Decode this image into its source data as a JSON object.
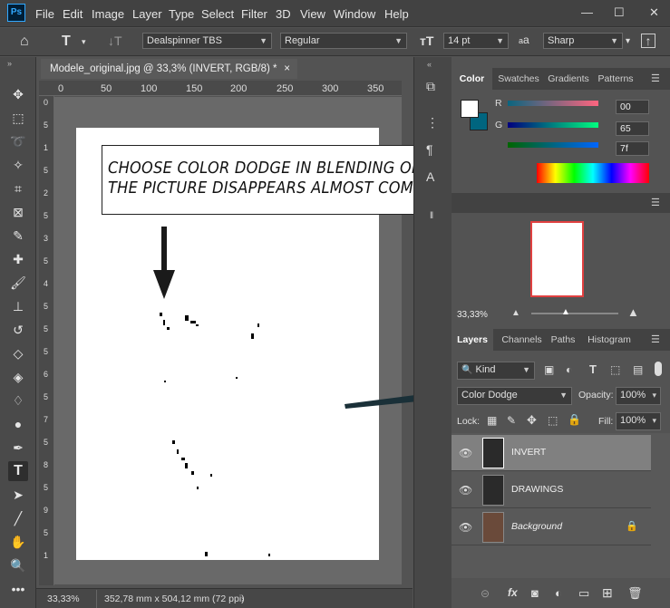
{
  "app": {
    "logo": "Ps"
  },
  "menu": [
    "File",
    "Edit",
    "Image",
    "Layer",
    "Type",
    "Select",
    "Filter",
    "3D",
    "View",
    "Window",
    "Help"
  ],
  "window_controls": [
    "—",
    "☐",
    "✕"
  ],
  "options_bar": {
    "font_family": "Dealspinner TBS",
    "font_style": "Regular",
    "font_size": "14 pt",
    "aa_label": "a",
    "anti_alias": "Sharp"
  },
  "document": {
    "tab_title": "Modele_original.jpg @ 33,3% (INVERT, RGB/8) *",
    "close_glyph": "×",
    "ruler_ticks": [
      "0",
      "50",
      "100",
      "150",
      "200",
      "250",
      "300",
      "350"
    ],
    "ruler_v_ticks": [
      "0",
      "5",
      "1",
      "5",
      "2",
      "5",
      "3",
      "5",
      "4",
      "5",
      "5",
      "5",
      "6",
      "5",
      "7",
      "5",
      "8",
      "5",
      "9",
      "5",
      "1"
    ]
  },
  "annotation": {
    "line1": "CHOOSE COLOR DODGE IN BLENDING OPTIONS",
    "line2": "THE PICTURE DISAPPEARS ALMOST COMPLETELY"
  },
  "status": {
    "zoom": "33,33%",
    "dimensions": "352,78 mm x 504,12 mm (72 ppi)",
    "arrow": "›"
  },
  "color_panel": {
    "tabs": [
      "Color",
      "Swatches",
      "Gradients",
      "Patterns"
    ],
    "r_label": "R",
    "r_value": "00",
    "g_label": "G",
    "g_value": "65",
    "b_value": "7f",
    "foreground": "#ffffff",
    "background": "#00657f"
  },
  "navigator": {
    "zoom": "33,33%"
  },
  "layers_panel": {
    "tabs": [
      "Layers",
      "Channels",
      "Paths",
      "Histogram"
    ],
    "filter": "Kind",
    "blend_mode": "Color Dodge",
    "opacity_label": "Opacity:",
    "opacity": "100%",
    "lock_label": "Lock:",
    "fill_label": "Fill:",
    "fill": "100%",
    "layers": [
      {
        "name": "INVERT",
        "selected": true
      },
      {
        "name": "DRAWINGS",
        "selected": false
      },
      {
        "name": "Background",
        "selected": false
      }
    ],
    "footer_icons": [
      "link-icon",
      "fx-icon",
      "mask-icon",
      "adjustment-icon",
      "group-icon",
      "new-layer-icon",
      "trash-icon"
    ],
    "fx_label": "fx"
  }
}
